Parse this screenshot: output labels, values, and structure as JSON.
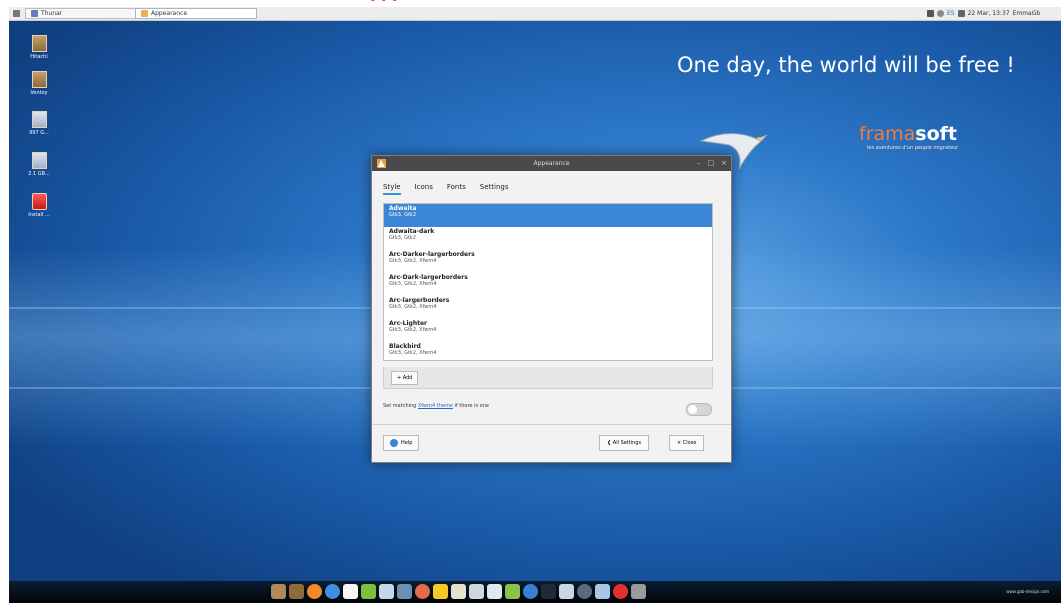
{
  "top_panel": {
    "tasks": [
      {
        "label": "Thunar"
      },
      {
        "label": "Appearance"
      }
    ],
    "tray_text": "ES",
    "clock": "22 Mar, 13:37",
    "user": "EmmaGb"
  },
  "desktop_icons": [
    {
      "label": "Hitachi"
    },
    {
      "label": "Ventoy"
    },
    {
      "label": "997 G..."
    },
    {
      "label": "2.1 GB..."
    },
    {
      "label": "Install ..."
    }
  ],
  "wallpaper": {
    "slogan": "One day, the world will be free !",
    "brand_light": "frama",
    "brand_bold": "soft",
    "brand_sub": "les aventures d'un peuple migrateur"
  },
  "window": {
    "title": "Appearance",
    "tabs": [
      "Style",
      "Icons",
      "Fonts",
      "Settings"
    ],
    "themes": [
      {
        "name": "Adwaita",
        "sub": "Gtk3, Gtk2",
        "selected": true
      },
      {
        "name": "Adwaita-dark",
        "sub": "Gtk3, Gtk2"
      },
      {
        "name": "Arc-Darker-largerborders",
        "sub": "Gtk3, Gtk2, Xfwm4"
      },
      {
        "name": "Arc-Dark-largerborders",
        "sub": "Gtk3, Gtk2, Xfwm4"
      },
      {
        "name": "Arc-largerborders",
        "sub": "Gtk3, Gtk2, Xfwm4"
      },
      {
        "name": "Arc-Lighter",
        "sub": "Gtk3, Gtk2, Xfwm4"
      },
      {
        "name": "Blackbird",
        "sub": "Gtk3, Gtk2, Xfwm4"
      }
    ],
    "add_label": "+ Add",
    "match_prefix": "Set matching",
    "match_link": "Xfwm4 theme",
    "match_suffix": "if there is one",
    "help_label": "Help",
    "all_settings_label": "❮ All Settings",
    "close_label": "× Close"
  },
  "footer_credit": "www.gab-design.com"
}
